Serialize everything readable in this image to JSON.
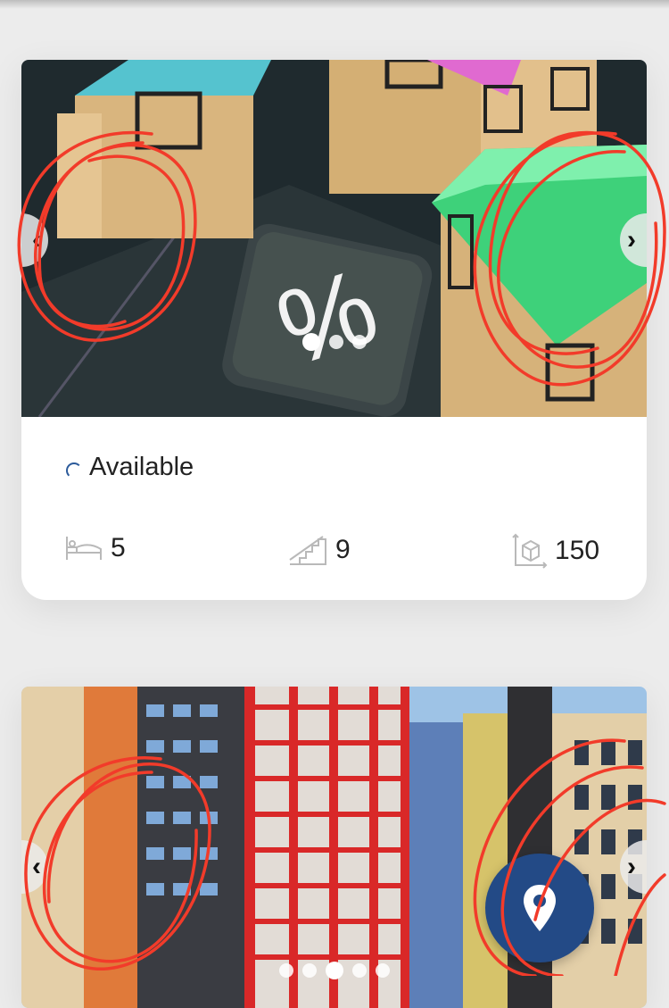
{
  "cards": [
    {
      "status": "Available",
      "bedrooms": "5",
      "floors": "9",
      "area": "150",
      "carousel": {
        "slides": 3,
        "active_index": 0
      }
    },
    {
      "carousel": {
        "slides": 5,
        "active_index": 2
      }
    }
  ],
  "icons": {
    "prev": "chevron-left-icon",
    "next": "chevron-right-icon",
    "bed": "bed-icon",
    "stairs": "stairs-icon",
    "area": "area-cube-icon",
    "location": "map-pin-icon"
  },
  "colors": {
    "accent": "#234a86",
    "annotation": "#f23b2a",
    "spinner": "#2b5a9a"
  }
}
